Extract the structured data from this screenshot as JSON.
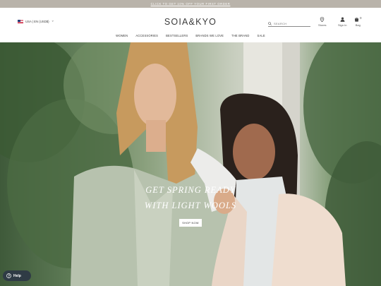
{
  "promo": {
    "text": "CLICK TO GET 10% OFF YOUR FIRST ORDER"
  },
  "header": {
    "region_label": "USA | EN (USD$)",
    "logo": "SOIA&KYO",
    "search_placeholder": "SEARCH",
    "stores_label": "Stores",
    "signin_label": "Sign In",
    "bag_label": "Bag",
    "bag_count": "0"
  },
  "nav": {
    "items": [
      {
        "label": "WOMEN"
      },
      {
        "label": "ACCESSORIES"
      },
      {
        "label": "BESTSELLERS"
      },
      {
        "label": "BRANDS WE LOVE"
      },
      {
        "label": "THE BRAND"
      },
      {
        "label": "SALE"
      }
    ]
  },
  "hero": {
    "headline_line1": "GET SPRING READY",
    "headline_line2": "WITH LIGHT WOOLS",
    "cta_label": "SHOP NOW"
  },
  "help": {
    "label": "Help"
  },
  "colors": {
    "promo_bg": "#b9b3aa",
    "accent_text": "#2b2b2b",
    "help_bg": "#2f3b45"
  },
  "icons": {
    "search": "search-icon",
    "stores": "location-pin-icon",
    "signin": "user-icon",
    "bag": "shopping-bag-icon",
    "help": "help-circle-icon",
    "region": "us-flag-icon"
  }
}
